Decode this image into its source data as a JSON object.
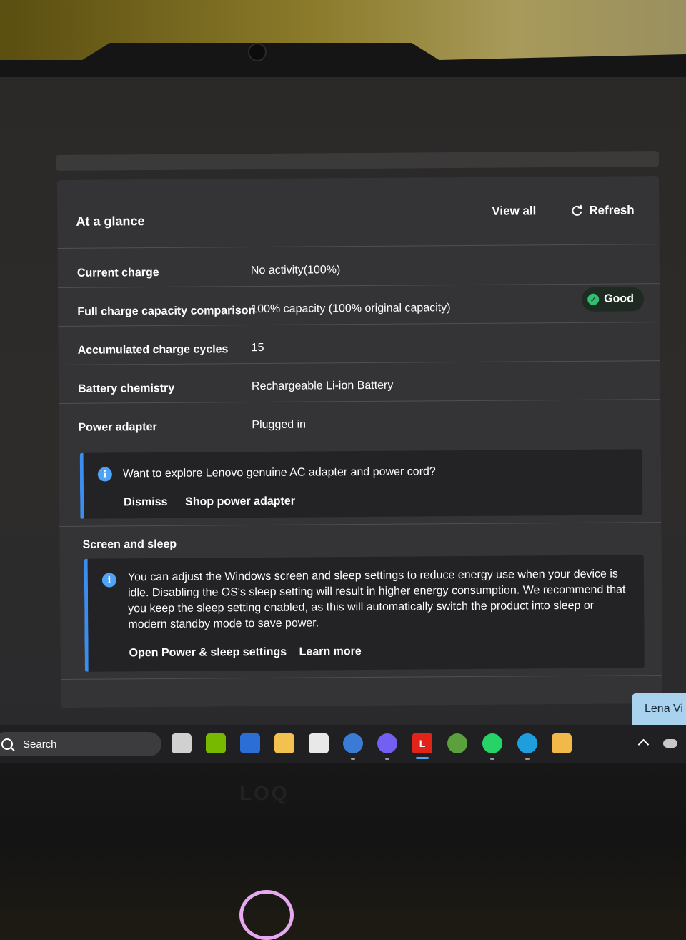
{
  "card": {
    "title": "At a glance",
    "view_all_label": "View all",
    "refresh_label": "Refresh"
  },
  "rows": [
    {
      "label": "Current charge",
      "value": "No activity(100%)"
    },
    {
      "label": "Full charge capacity comparison",
      "value": "100% capacity (100% original capacity)"
    },
    {
      "label": "Accumulated charge cycles",
      "value": "15"
    },
    {
      "label": "Battery chemistry",
      "value": "Rechargeable Li-ion Battery"
    },
    {
      "label": "Power adapter",
      "value": "Plugged in"
    }
  ],
  "badge": {
    "label": "Good",
    "color": "#2fbf6e"
  },
  "adapter_notice": {
    "text": "Want to explore Lenovo genuine AC adapter and power cord?",
    "dismiss_label": "Dismiss",
    "shop_label": "Shop power adapter"
  },
  "screen_sleep": {
    "title": "Screen and sleep",
    "text": "You can adjust the Windows screen and sleep settings to reduce energy use when your device is idle. Disabling the OS's sleep setting will result in higher energy consumption. We recommend that you keep the sleep setting enabled, as this will automatically switch the product into sleep or modern standby mode to save power.",
    "open_settings_label": "Open Power & sleep settings",
    "learn_more_label": "Learn more"
  },
  "taskbar": {
    "search_label": "Search",
    "apps": [
      {
        "name": "task-view-icon",
        "color": "#d0d0d0"
      },
      {
        "name": "nvidia-icon",
        "color": "#76b900"
      },
      {
        "name": "word-icon",
        "color": "#2b6fd6"
      },
      {
        "name": "file-explorer-icon",
        "color": "#f2c14e"
      },
      {
        "name": "microsoft-store-icon",
        "color": "#e8e8e8"
      },
      {
        "name": "audio-app-icon",
        "color": "#3a7bd5"
      },
      {
        "name": "viber-icon",
        "color": "#7360f2"
      },
      {
        "name": "lenovo-vantage-icon",
        "color": "#e2231a"
      },
      {
        "name": "maps-app-icon",
        "color": "#5aa03c"
      },
      {
        "name": "whatsapp-icon",
        "color": "#25d366"
      },
      {
        "name": "edge-icon",
        "color": "#1f9ede"
      },
      {
        "name": "paint-icon",
        "color": "#f0b94a"
      }
    ],
    "tooltip_label": "Lena Vi"
  },
  "accent_color": "#3b8df0"
}
